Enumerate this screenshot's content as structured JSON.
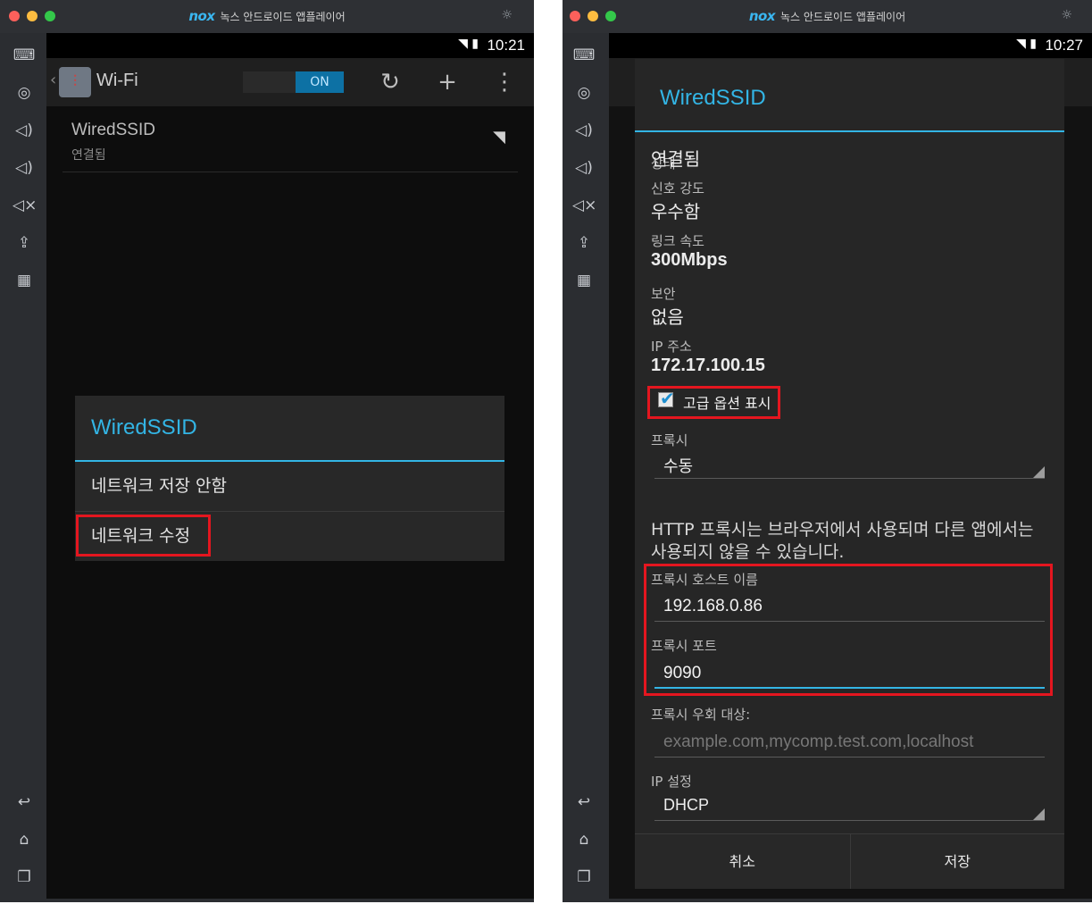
{
  "window": {
    "brand": "nox",
    "title": "녹스 안드로이드 앱플레이어",
    "settings_icon": "gear-icon"
  },
  "left": {
    "status_time": "10:21",
    "actionbar": {
      "title": "Wi-Fi",
      "toggle_label": "ON"
    },
    "network": {
      "name": "WiredSSID",
      "state": "연결됨"
    },
    "dialog": {
      "title": "WiredSSID",
      "items": [
        "네트워크 저장 안함",
        "네트워크 수정"
      ]
    }
  },
  "right": {
    "status_time": "10:27",
    "dialog": {
      "title": "WiredSSID",
      "status_label": "상태",
      "status_value": "연결됨",
      "signal_label": "신호 강도",
      "signal_value": "우수함",
      "link_label": "링크 속도",
      "link_value": "300Mbps",
      "security_label": "보안",
      "security_value": "없음",
      "ip_label": "IP 주소",
      "ip_value": "172.17.100.15",
      "advanced_label": "고급 옵션 표시",
      "advanced_checked": true,
      "proxy_label": "프록시",
      "proxy_value": "수동",
      "proxy_note": "HTTP 프록시는 브라우저에서 사용되며 다른 앱에서는 사용되지 않을 수 있습니다.",
      "host_label": "프록시 호스트 이름",
      "host_value": "192.168.0.86",
      "port_label": "프록시 포트",
      "port_value": "9090",
      "bypass_label": "프록시 우회 대상:",
      "bypass_placeholder": "example.com,mycomp.test.com,localhost",
      "ipset_label": "IP 설정",
      "ipset_value": "DHCP",
      "cancel_label": "취소",
      "save_label": "저장"
    }
  },
  "colors": {
    "accent": "#33b5e5",
    "highlight": "#e4161f",
    "toggle_on": "#0d71a4"
  }
}
